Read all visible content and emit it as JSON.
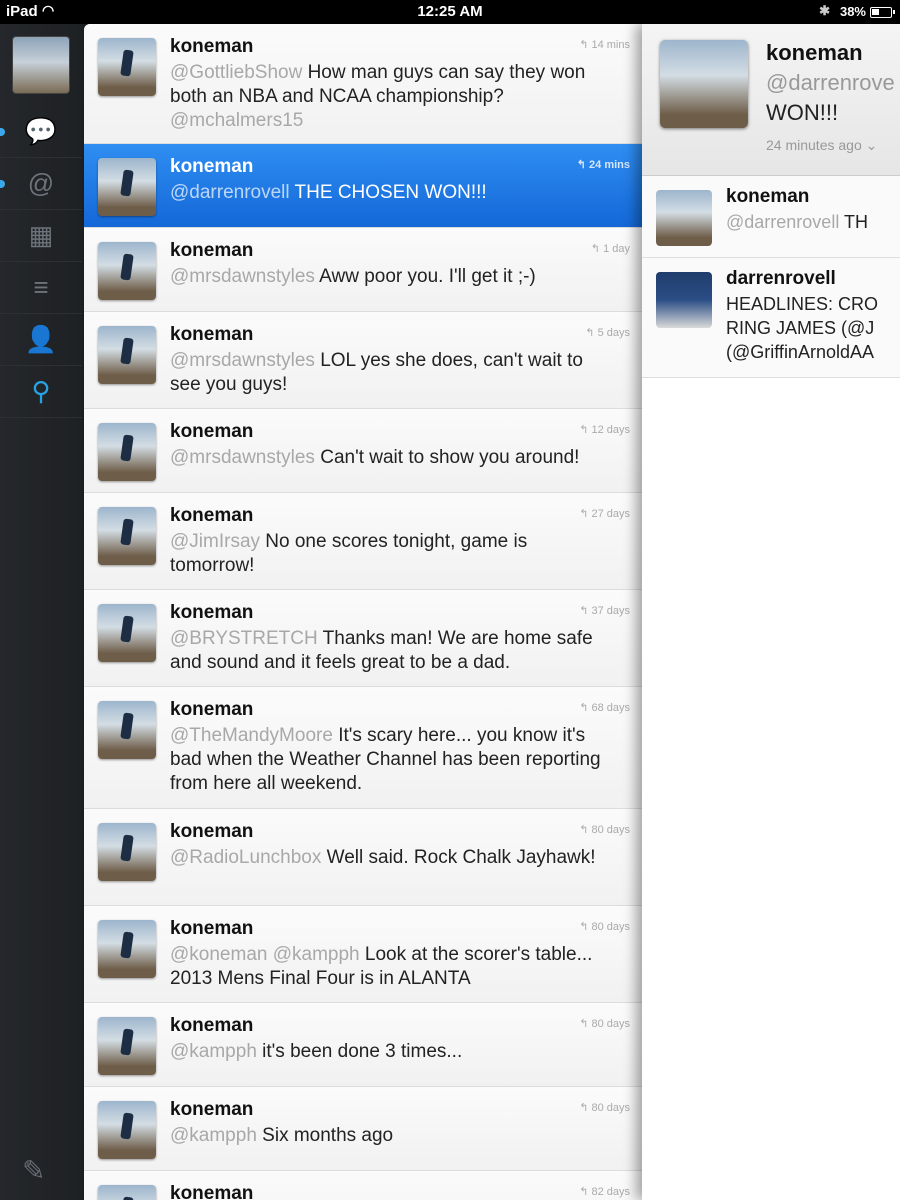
{
  "status_bar": {
    "carrier": "iPad",
    "time": "12:25 AM",
    "battery": "38%",
    "battery_level": 0.38
  },
  "sidebar": {
    "items": [
      {
        "icon": "speech-bubble-icon",
        "glyph": "💬",
        "active": false,
        "unread": true
      },
      {
        "icon": "at-sign-icon",
        "glyph": "@",
        "active": false,
        "unread": true
      },
      {
        "icon": "lists-icon",
        "glyph": "▦",
        "active": false,
        "unread": false
      },
      {
        "icon": "menu-lines-icon",
        "glyph": "≡",
        "active": false,
        "unread": false
      },
      {
        "icon": "profile-icon",
        "glyph": "👤",
        "active": false,
        "unread": false
      },
      {
        "icon": "search-icon",
        "glyph": "⚲",
        "active": true,
        "unread": false
      }
    ],
    "compose_icon": "compose-icon"
  },
  "timeline": {
    "tweets": [
      {
        "name": "koneman",
        "mention": "@GottliebShow",
        "text": " How man guys can say they won both an NBA and NCAA championship? ",
        "mention2": "@mchalmers15",
        "time": "14 mins",
        "selected": false
      },
      {
        "name": "koneman",
        "mention": "@darrenrovell",
        "text": "  THE CHOSEN WON!!!",
        "mention2": "",
        "time": "24 mins",
        "selected": true
      },
      {
        "name": "koneman",
        "mention": "@mrsdawnstyles",
        "text": " Aww poor you. I'll get it ;-)",
        "mention2": "",
        "time": "1 day",
        "selected": false
      },
      {
        "name": "koneman",
        "mention": "@mrsdawnstyles",
        "text": " LOL yes she does, can't wait to see you guys!",
        "mention2": "",
        "time": "5 days",
        "selected": false
      },
      {
        "name": "koneman",
        "mention": "@mrsdawnstyles",
        "text": " Can't wait to show you around!",
        "mention2": "",
        "time": "12 days",
        "selected": false
      },
      {
        "name": "koneman",
        "mention": "@JimIrsay",
        "text": " No one scores tonight, game is tomorrow!",
        "mention2": "",
        "time": "27 days",
        "selected": false
      },
      {
        "name": "koneman",
        "mention": "@BRYSTRETCH",
        "text": " Thanks man! We are home safe and sound and it feels great to be a dad.",
        "mention2": "",
        "time": "37 days",
        "selected": false
      },
      {
        "name": "koneman",
        "mention": "@TheMandyMoore",
        "text": " It's scary here... you know it's bad when the Weather Channel has been reporting from here all weekend.",
        "mention2": "",
        "time": "68 days",
        "selected": false
      },
      {
        "name": "koneman",
        "mention": "@RadioLunchbox",
        "text": " Well said. Rock Chalk Jayhawk!",
        "mention2": "",
        "time": "80 days",
        "selected": false
      },
      {
        "name": "koneman",
        "mention": "@koneman @kampph",
        "text": " Look at the scorer's table... 2013 Mens Final Four is in ALANTA",
        "mention2": "",
        "time": "80 days",
        "selected": false
      },
      {
        "name": "koneman",
        "mention": "@kampph",
        "text": " it's been done 3 times...",
        "mention2": "",
        "time": "80 days",
        "selected": false
      },
      {
        "name": "koneman",
        "mention": "@kampph",
        "text": " Six months ago",
        "mention2": "",
        "time": "80 days",
        "selected": false
      },
      {
        "name": "koneman",
        "mention": "",
        "text": "",
        "mention2": "",
        "time": "82 days",
        "selected": false
      }
    ]
  },
  "detail": {
    "name": "koneman",
    "mention": "@darrenrove",
    "body": "WON!!!",
    "ago": "24 minutes ago",
    "related": [
      {
        "name": "koneman",
        "mention": "@darrenrovell",
        "text": "  TH",
        "avatar": "user"
      },
      {
        "name": "darrenrovell",
        "text_lines": [
          "HEADLINES: CRO",
          "RING JAMES (@J",
          "(@GriffinArnoldAA"
        ],
        "avatar": "news"
      }
    ]
  }
}
